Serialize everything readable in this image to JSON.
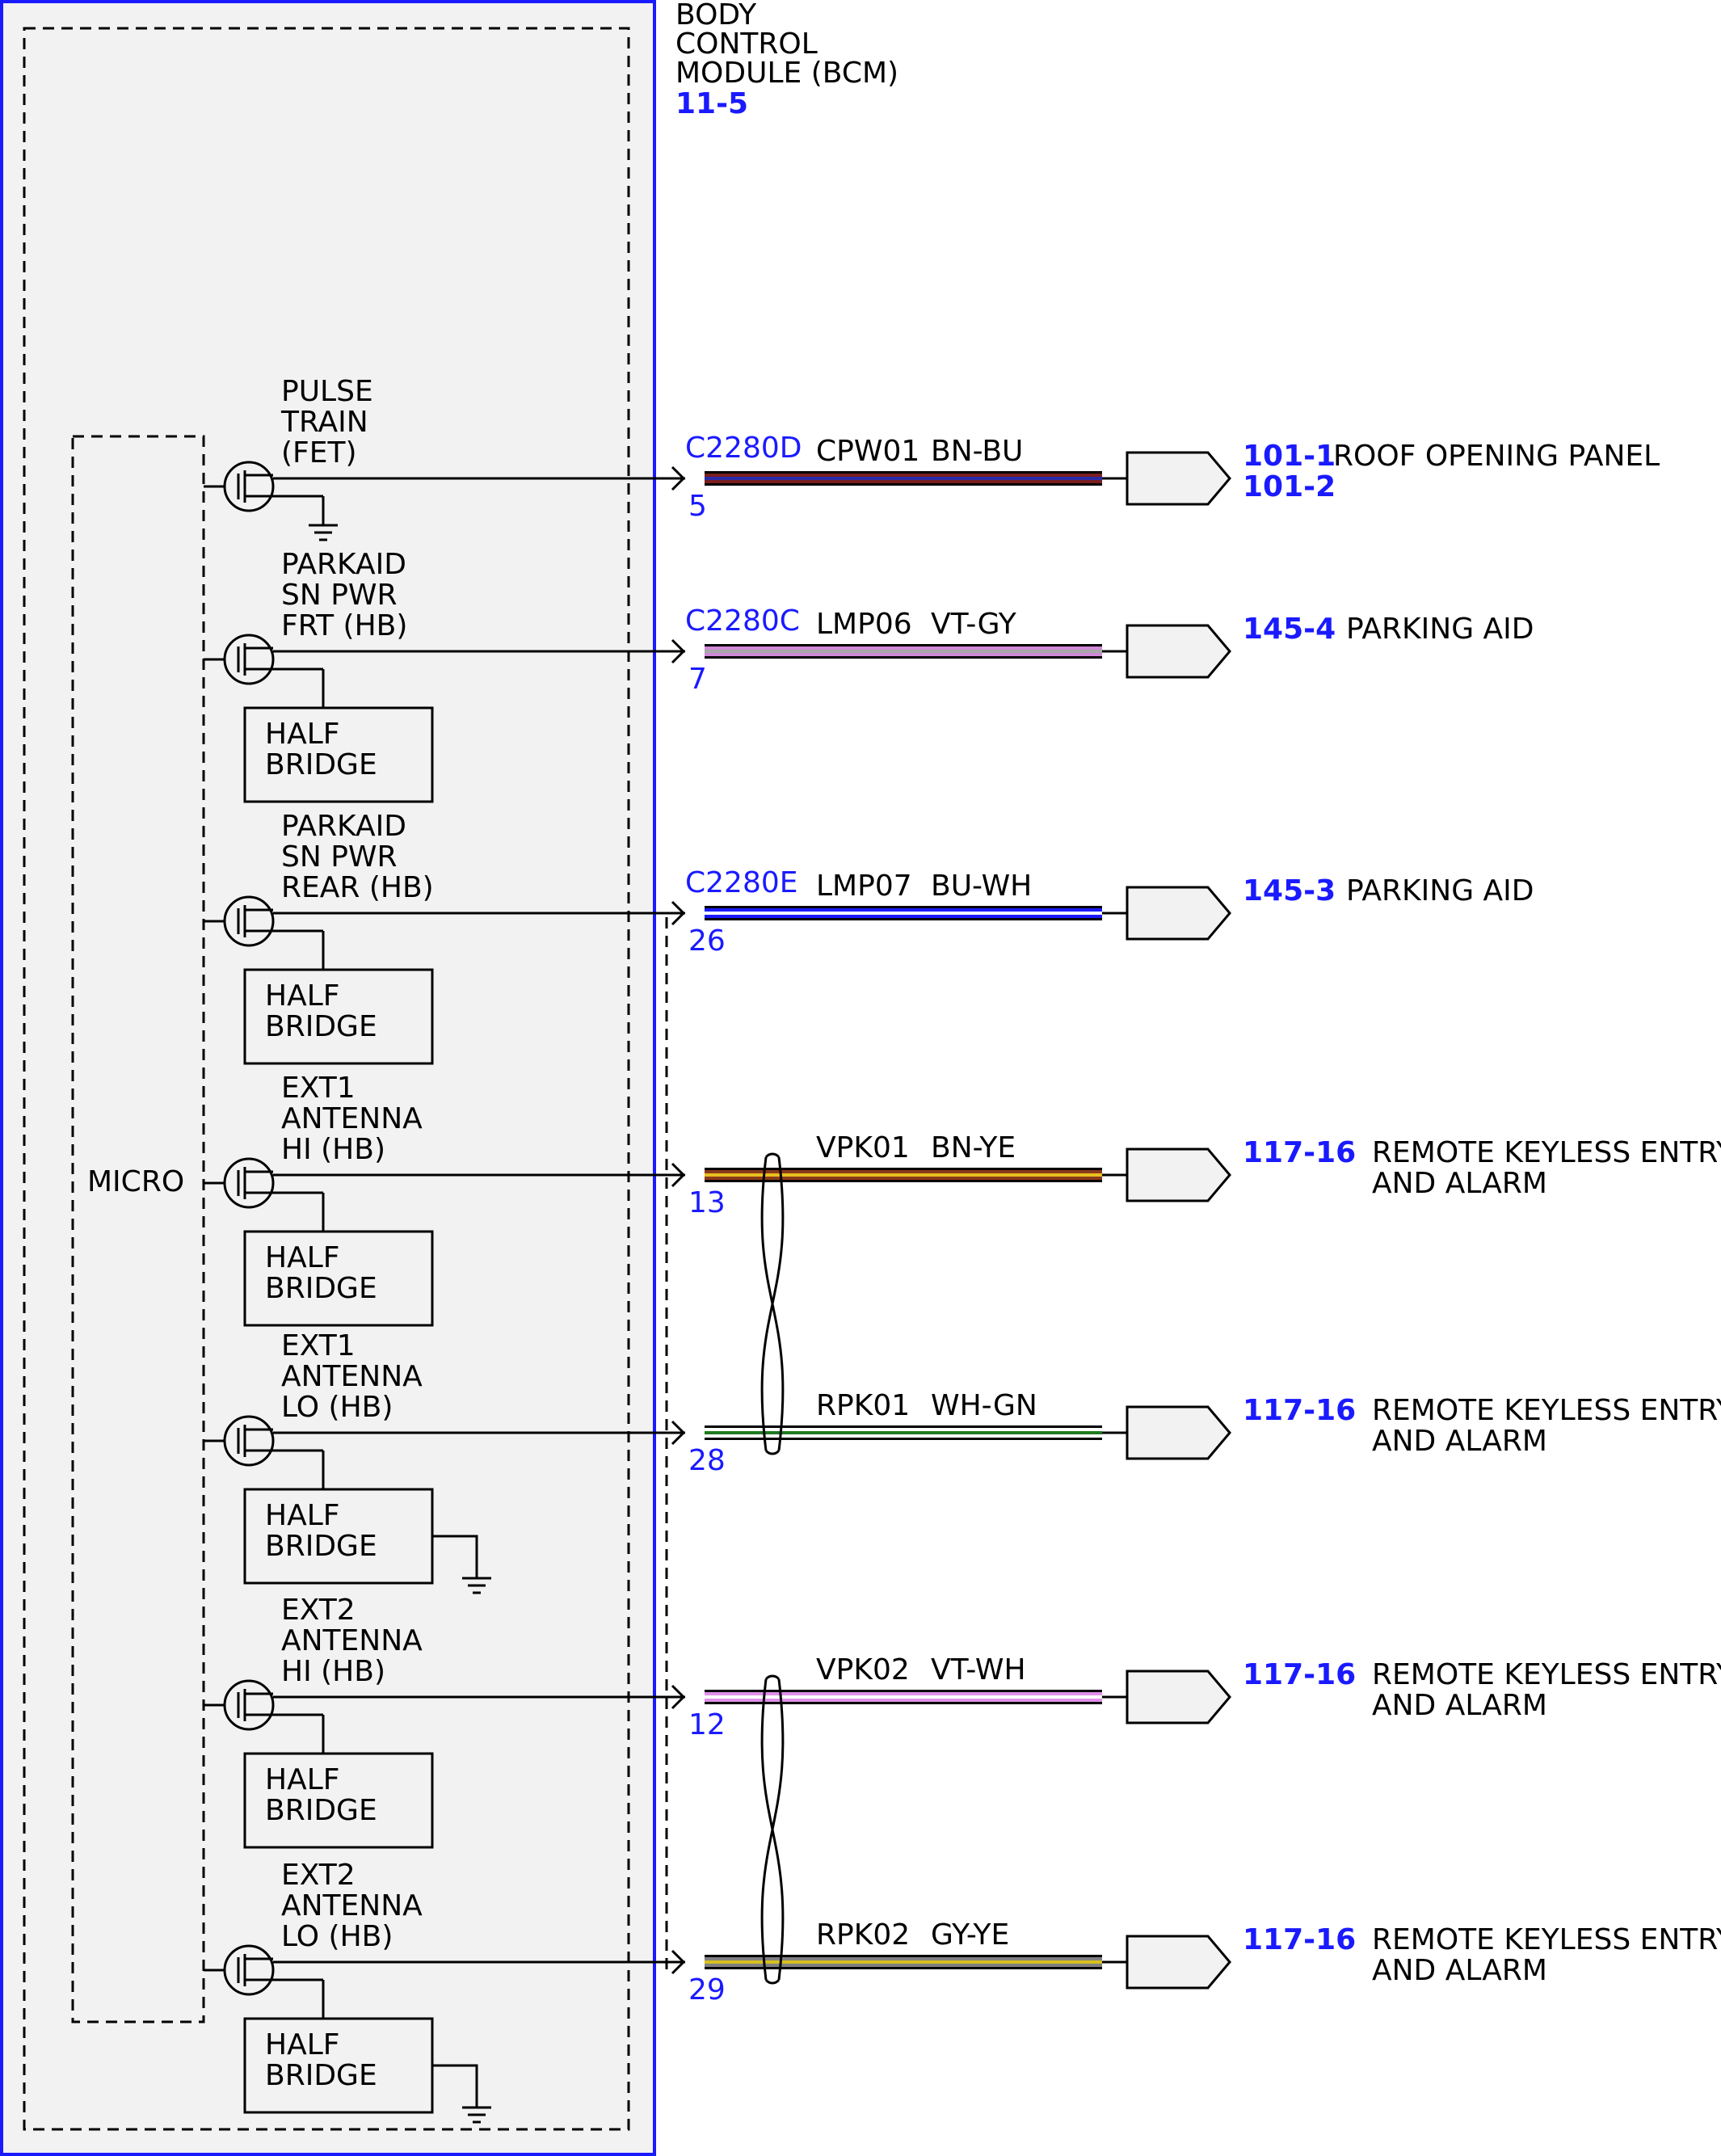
{
  "module": {
    "name_lines": [
      "BODY",
      "CONTROL",
      "MODULE (BCM)"
    ],
    "ref": "11-5",
    "micro_label": "MICRO",
    "half_bridge_lines": [
      "HALF",
      "BRIDGE"
    ]
  },
  "circuits": [
    {
      "label_lines": [
        "PULSE",
        "TRAIN",
        "(FET)"
      ],
      "connector": "C2280D",
      "pin": "5",
      "circuit": "CPW01",
      "color_code": "BN-BU",
      "wire_colors": [
        "#7a1f1f",
        "#2a2aa8"
      ],
      "refs": [
        "101-1",
        "101-2"
      ],
      "dest_lines": [
        "ROOF OPENING PANEL"
      ],
      "half_bridge": false,
      "ground": "fet"
    },
    {
      "label_lines": [
        "PARKAID",
        "SN PWR",
        "FRT (HB)"
      ],
      "connector": "C2280C",
      "pin": "7",
      "circuit": "LMP06",
      "color_code": "VT-GY",
      "wire_colors": [
        "#d088d8",
        "#a8a8a8"
      ],
      "refs": [
        "145-4"
      ],
      "dest_lines": [
        "PARKING AID"
      ],
      "half_bridge": true,
      "ground": "none"
    },
    {
      "label_lines": [
        "PARKAID",
        "SN PWR",
        "REAR (HB)"
      ],
      "connector": "C2280E",
      "pin": "26",
      "circuit": "LMP07",
      "color_code": "BU-WH",
      "wire_colors": [
        "#1a1aff",
        "#ffffff"
      ],
      "refs": [
        "145-3"
      ],
      "dest_lines": [
        "PARKING AID"
      ],
      "half_bridge": true,
      "ground": "none"
    },
    {
      "label_lines": [
        "EXT1",
        "ANTENNA",
        "HI (HB)"
      ],
      "connector": "",
      "pin": "13",
      "circuit": "VPK01",
      "color_code": "BN-YE",
      "wire_colors": [
        "#8b3a1a",
        "#e8c020"
      ],
      "refs": [
        "117-16"
      ],
      "dest_lines": [
        "REMOTE KEYLESS ENTRY",
        "AND ALARM"
      ],
      "half_bridge": true,
      "ground": "none"
    },
    {
      "label_lines": [
        "EXT1",
        "ANTENNA",
        "LO (HB)"
      ],
      "connector": "",
      "pin": "28",
      "circuit": "RPK01",
      "color_code": "WH-GN",
      "wire_colors": [
        "#ffffff",
        "#1f7a1f"
      ],
      "refs": [
        "117-16"
      ],
      "dest_lines": [
        "REMOTE KEYLESS ENTRY",
        "AND ALARM"
      ],
      "half_bridge": true,
      "ground": "hb"
    },
    {
      "label_lines": [
        "EXT2",
        "ANTENNA",
        "HI (HB)"
      ],
      "connector": "",
      "pin": "12",
      "circuit": "VPK02",
      "color_code": "VT-WH",
      "wire_colors": [
        "#e090e8",
        "#ffffff"
      ],
      "refs": [
        "117-16"
      ],
      "dest_lines": [
        "REMOTE KEYLESS ENTRY",
        "AND ALARM"
      ],
      "half_bridge": true,
      "ground": "none"
    },
    {
      "label_lines": [
        "EXT2",
        "ANTENNA",
        "LO (HB)"
      ],
      "connector": "",
      "pin": "29",
      "circuit": "RPK02",
      "color_code": "GY-YE",
      "wire_colors": [
        "#808080",
        "#d8c020"
      ],
      "refs": [
        "117-16"
      ],
      "dest_lines": [
        "REMOTE KEYLESS ENTRY",
        "AND ALARM"
      ],
      "half_bridge": true,
      "ground": "hb"
    }
  ]
}
